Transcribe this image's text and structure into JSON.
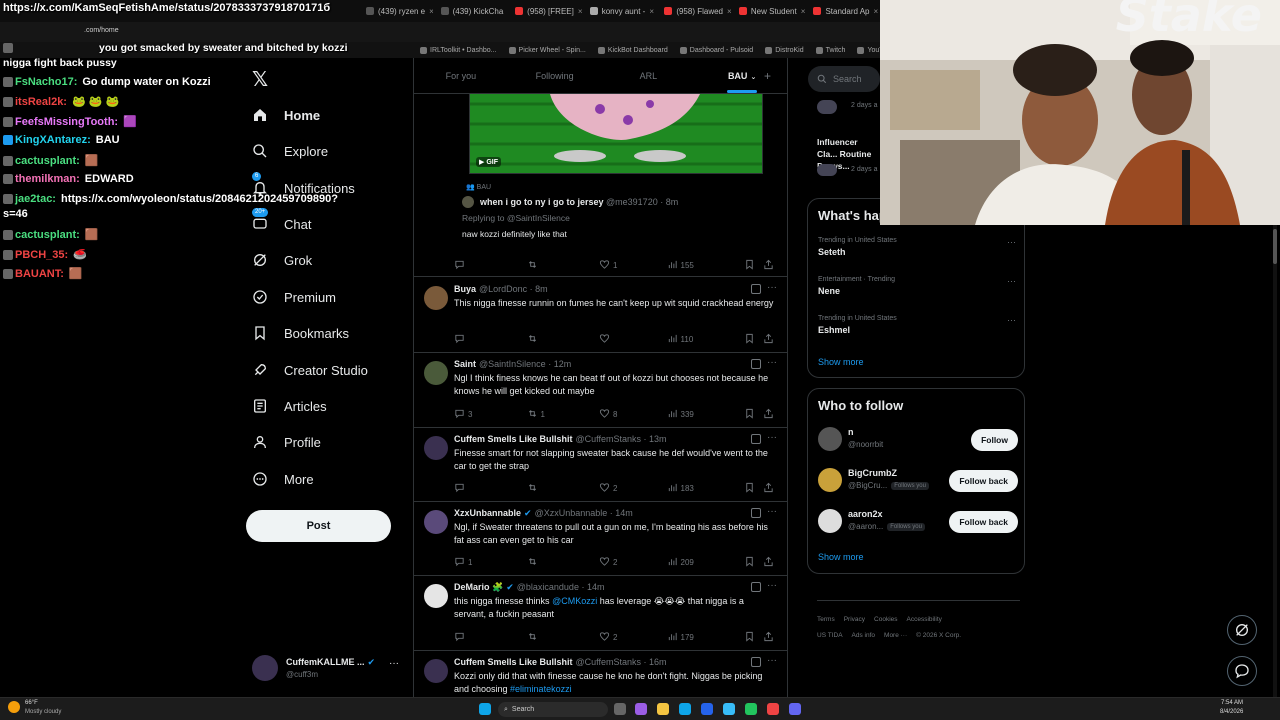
{
  "browser": {
    "tabs": [
      {
        "label": "(439) ryzen e",
        "color": "#555"
      },
      {
        "label": "(439) KickCha",
        "color": "#555"
      },
      {
        "label": "(958) [FREE]",
        "color": "#e33"
      },
      {
        "label": "konvy aunt -",
        "color": "#aaa"
      },
      {
        "label": "(958) Flawed",
        "color": "#e33"
      },
      {
        "label": "New Student",
        "color": "#e33"
      },
      {
        "label": "Standard Ap",
        "color": "#e33"
      }
    ],
    "url_fragment": ".com/home",
    "bookmarks": [
      "IRLToolkit • Dashbo...",
      "Picker Wheel - Spin...",
      "KickBot Dashboard",
      "Dashboard - Pulsoid",
      "DistroKid",
      "Twitch",
      "YouTube to WAV D..."
    ]
  },
  "chat": {
    "url_line": "https://x.com/KamSeqFetishAme/status/207833373791870171б",
    "line2": "you got smacked by sweater and bitched by kozzi",
    "line3": "nigga fight back pussy",
    "messages": [
      {
        "user": "FsNacho17:",
        "text": "Go dump water on Kozzi",
        "color": "#4ade80"
      },
      {
        "user": "itsReal2k:",
        "text": "🐸 🐸 🐸",
        "color": "#ef4444"
      },
      {
        "user": "FeefsMissingTooth:",
        "text": "🟪",
        "color": "#e879f9"
      },
      {
        "user": "KingXAntarez:",
        "text": "BAU",
        "color": "#22d3ee"
      },
      {
        "user": "cactusplant:",
        "text": "🟫",
        "color": "#4ade80"
      },
      {
        "user": "themilkman:",
        "text": "EDWARD",
        "color": "#f472b6"
      },
      {
        "user": "jae2tac:",
        "text": "https://x.com/wyoleon/status/2084621202459709890?",
        "color": "#4ade80"
      },
      {
        "user": "",
        "text": "s=46",
        "color": "#fff"
      },
      {
        "user": "cactusplant:",
        "text": "🟫",
        "color": "#4ade80"
      },
      {
        "user": "PBCH_35:",
        "text": "🥌",
        "color": "#ef4444"
      },
      {
        "user": "BAUANT:",
        "text": "🟫",
        "color": "#ef4444"
      }
    ]
  },
  "nav": {
    "logo": "𝕏",
    "items": [
      {
        "label": "Home",
        "icon": "home-icon"
      },
      {
        "label": "Explore",
        "icon": "search-icon"
      },
      {
        "label": "Notifications",
        "icon": "bell-icon",
        "badge": "6"
      },
      {
        "label": "Chat",
        "icon": "chat-icon",
        "badge": "20+"
      },
      {
        "label": "Grok",
        "icon": "grok-icon"
      },
      {
        "label": "Premium",
        "icon": "premium-icon"
      },
      {
        "label": "Bookmarks",
        "icon": "bookmark-icon"
      },
      {
        "label": "Creator Studio",
        "icon": "rocket-icon"
      },
      {
        "label": "Articles",
        "icon": "article-icon"
      },
      {
        "label": "Profile",
        "icon": "person-icon"
      },
      {
        "label": "More",
        "icon": "more-icon"
      }
    ],
    "post_label": "Post",
    "account": {
      "name": "CuffemKALLME ...",
      "handle": "@cuff3m"
    }
  },
  "feed": {
    "tabs": [
      "For you",
      "Following",
      "ARL",
      "BAU"
    ],
    "selected_tab": "BAU",
    "gif_label": "GIF",
    "quote": {
      "community": "BAU",
      "name": "when i go to ny i go to jersey",
      "handle": "@me391720 · 8m",
      "replying": "Replying to @SaintInSilence",
      "text": "naw kozzi definitely like that",
      "likes": "1",
      "views": "155"
    },
    "tweets": [
      {
        "name": "Buya",
        "handle": "@LordDonc · 8m",
        "text": "This nigga finesse runnin on fumes he can't keep up wit squid crackhead energy",
        "replies": "",
        "retweets": "",
        "likes": "",
        "views": "110",
        "avatar": "#7a5a3a"
      },
      {
        "name": "Saint",
        "handle": "@SaintInSilence · 12m",
        "text": "Ngl I think finess knows he can beat tf out of kozzi but chooses not because he knows he will get kicked out maybe",
        "replies": "3",
        "retweets": "1",
        "likes": "8",
        "views": "339",
        "avatar": "#4a5a3a"
      },
      {
        "name": "Cuffem Smells Like Bullshit",
        "handle": "@CuffemStanks · 13m",
        "text": "Finesse smart for not slapping sweater back cause he def would've went to the car to get the strap",
        "replies": "",
        "retweets": "",
        "likes": "2",
        "views": "183",
        "avatar": "#3a3050"
      },
      {
        "name": "XzxUnbannable",
        "handle": "@XzxUnbannable · 14m",
        "text": "Ngl, if Sweater threatens to pull out a gun on me, I'm beating his ass before his fat ass can even get to his car",
        "replies": "1",
        "retweets": "",
        "likes": "2",
        "views": "209",
        "avatar": "#5a4a7a"
      },
      {
        "name": "DeMario 🧩",
        "handle": "@blaxicandude · 14m",
        "text_before": "this nigga finesse thinks ",
        "mention": "@CMKozzi",
        "text_after": " has leverage 😭😭😭 that nigga is a servant, a fuckin peasant",
        "replies": "",
        "retweets": "",
        "likes": "2",
        "views": "179",
        "avatar": "#e5e5e5"
      },
      {
        "name": "Cuffem Smells Like Bullshit",
        "handle": "@CuffemStanks · 16m",
        "text_before": "Kozzi only did that with finesse cause he kno he don't fight. Niggas be picking and choosing ",
        "mention": "#eliminatekozzi",
        "avatar": "#3a3050"
      }
    ]
  },
  "right": {
    "search_placeholder": "Search",
    "partial": {
      "time1": "2 days a",
      "title": "Influencer Cla... Routine Draws...",
      "time2": "2 days a"
    },
    "happening_title": "What's hap",
    "trends": [
      {
        "meta": "Trending in United States",
        "text": "Seteth"
      },
      {
        "meta": "Entertainment · Trending",
        "text": "Nene"
      },
      {
        "meta": "Trending in United States",
        "text": "Eshmel"
      }
    ],
    "show_more": "Show more",
    "wtf_title": "Who to follow",
    "follow": [
      {
        "name": "n",
        "handle": "@noorrbit",
        "button": "Follow",
        "follows_you": "",
        "color": "#555"
      },
      {
        "name": "BigCrumbZ",
        "handle": "@BigCru...",
        "button": "Follow back",
        "follows_you": "Follows you",
        "color": "#c9a13a"
      },
      {
        "name": "aaron2x",
        "handle": "@aaron...",
        "button": "Follow back",
        "follows_you": "Follows you",
        "color": "#ddd"
      }
    ],
    "footer": [
      "Terms",
      "Privacy",
      "Cookies",
      "Accessibility",
      "US TIDA",
      "Ads info",
      "More ···",
      "© 2026 X Corp."
    ]
  },
  "webcam": {
    "logo": "Stake"
  },
  "taskbar": {
    "weather": "66°F",
    "weather_desc": "Mostly cloudy",
    "search": "Search",
    "time": "7:54 AM",
    "date": "8/4/2026"
  }
}
